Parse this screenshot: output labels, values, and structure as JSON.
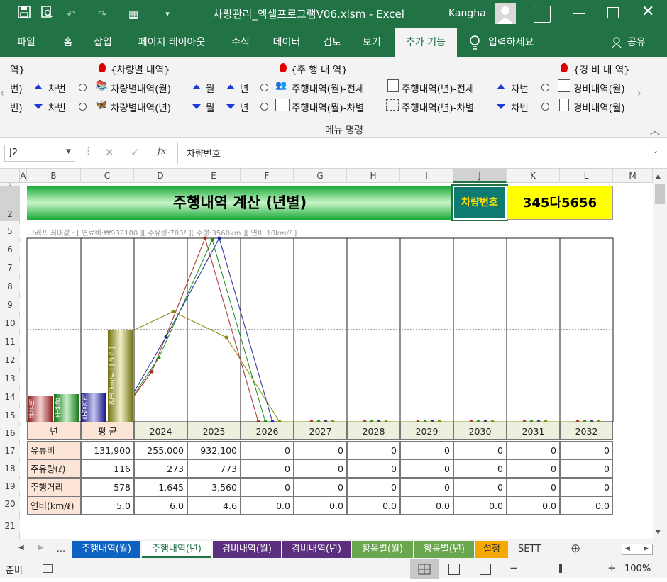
{
  "window": {
    "title": "차량관리_엑셀프로그램V06.xlsm  -  Excel",
    "user": "Kangha"
  },
  "menu": {
    "items": [
      "파일",
      "홈",
      "삽입",
      "페이지 레이아웃",
      "수식",
      "데이터",
      "검토",
      "보기",
      "추가 기능"
    ],
    "search": "입력하세요",
    "share": "공유"
  },
  "ribbon": {
    "group_label": "메뉴 명령",
    "headers": {
      "h1": "역}",
      "h2": "{차량별 내역}",
      "h3": "{주 행 내 역}",
      "h4": "{경 비 내 역}"
    },
    "row1": {
      "c0": "번)",
      "sort_carno": "차번",
      "item1": "차량별내역(월)",
      "sort_month": "월",
      "sort_year": "년",
      "item2": "주행내역(월)-전체",
      "item3": "주행내역(년)-전체",
      "sort_carno2": "차번",
      "item4": "경비내역(월)"
    },
    "row2": {
      "c0": "번)",
      "sort_carno": "차번",
      "item1": "차량별내역(년)",
      "sort_month": "월",
      "sort_year": "년",
      "item2": "주행내역(월)-차별",
      "item3": "주행내역(년)-차별",
      "sort_carno2": "차번",
      "item4": "경비내역(월)"
    }
  },
  "formula_bar": {
    "name_box": "J2",
    "fx": "fx",
    "content": "차량번호"
  },
  "columns": [
    "A",
    "B",
    "C",
    "D",
    "E",
    "F",
    "G",
    "H",
    "I",
    "J",
    "K",
    "L",
    "M"
  ],
  "rows": [
    "1",
    "2",
    "5",
    "6",
    "7",
    "8",
    "9",
    "10",
    "11",
    "12",
    "13",
    "14",
    "15",
    "16",
    "17",
    "18",
    "19",
    "20",
    "21"
  ],
  "sheet": {
    "title": "주행내역 계산 (년별)",
    "car_label": "차량번호",
    "car_no": "345다5656",
    "graph_max": "그래프 최대값 : [ 연료비:₩932100 ][ 주유량:780ℓ ][ 주행:3560km ][ 연비:10km/ℓ ]",
    "mini_bars": [
      "유류비",
      "주유량",
      "주행거리",
      "연비(km/ℓ) [ 5.0 ]"
    ],
    "table": {
      "head": [
        "년",
        "평 균",
        "2024",
        "2025",
        "2026",
        "2027",
        "2028",
        "2029",
        "2030",
        "2031",
        "2032"
      ],
      "rows": [
        {
          "label": "유류비",
          "values": [
            "131,900",
            "255,000",
            "932,100",
            "0",
            "0",
            "0",
            "0",
            "0",
            "0",
            "0"
          ]
        },
        {
          "label": "주유량(ℓ)",
          "values": [
            "116",
            "273",
            "773",
            "0",
            "0",
            "0",
            "0",
            "0",
            "0",
            "0"
          ]
        },
        {
          "label": "주행거리",
          "values": [
            "578",
            "1,645",
            "3,560",
            "0",
            "0",
            "0",
            "0",
            "0",
            "0",
            "0"
          ]
        },
        {
          "label": "연비(km/ℓ)",
          "values": [
            "5.0",
            "6.0",
            "4.6",
            "0.0",
            "0.0",
            "0.0",
            "0.0",
            "0.0",
            "0.0",
            "0.0"
          ]
        }
      ]
    }
  },
  "chart_data": {
    "type": "line",
    "categories": [
      "평 균",
      "2024",
      "2025",
      "2026",
      "2027",
      "2028",
      "2029",
      "2030",
      "2031",
      "2032"
    ],
    "series": [
      {
        "name": "유류비",
        "color": "#a52a2a",
        "values": [
          131900,
          255000,
          932100,
          0,
          0,
          0,
          0,
          0,
          0,
          0
        ],
        "max": 932100
      },
      {
        "name": "주유량",
        "color": "#1e8e1e",
        "values": [
          116,
          273,
          773,
          0,
          0,
          0,
          0,
          0,
          0,
          0
        ],
        "max": 780
      },
      {
        "name": "주행거리",
        "color": "#1a2a9a",
        "values": [
          578,
          1645,
          3560,
          0,
          0,
          0,
          0,
          0,
          0,
          0
        ],
        "max": 3560
      },
      {
        "name": "연비",
        "color": "#8a8a10",
        "values": [
          5.0,
          6.0,
          4.6,
          0,
          0,
          0,
          0,
          0,
          0,
          0
        ],
        "max": 10
      }
    ]
  },
  "tabs": [
    "...",
    "주행내역(월)",
    "주행내역(년)",
    "경비내역(월)",
    "경비내역(년)",
    "항목별(월)",
    "항목별(년)",
    "설정",
    "SETT"
  ],
  "status": {
    "ready": "준비",
    "zoom": "100%"
  }
}
